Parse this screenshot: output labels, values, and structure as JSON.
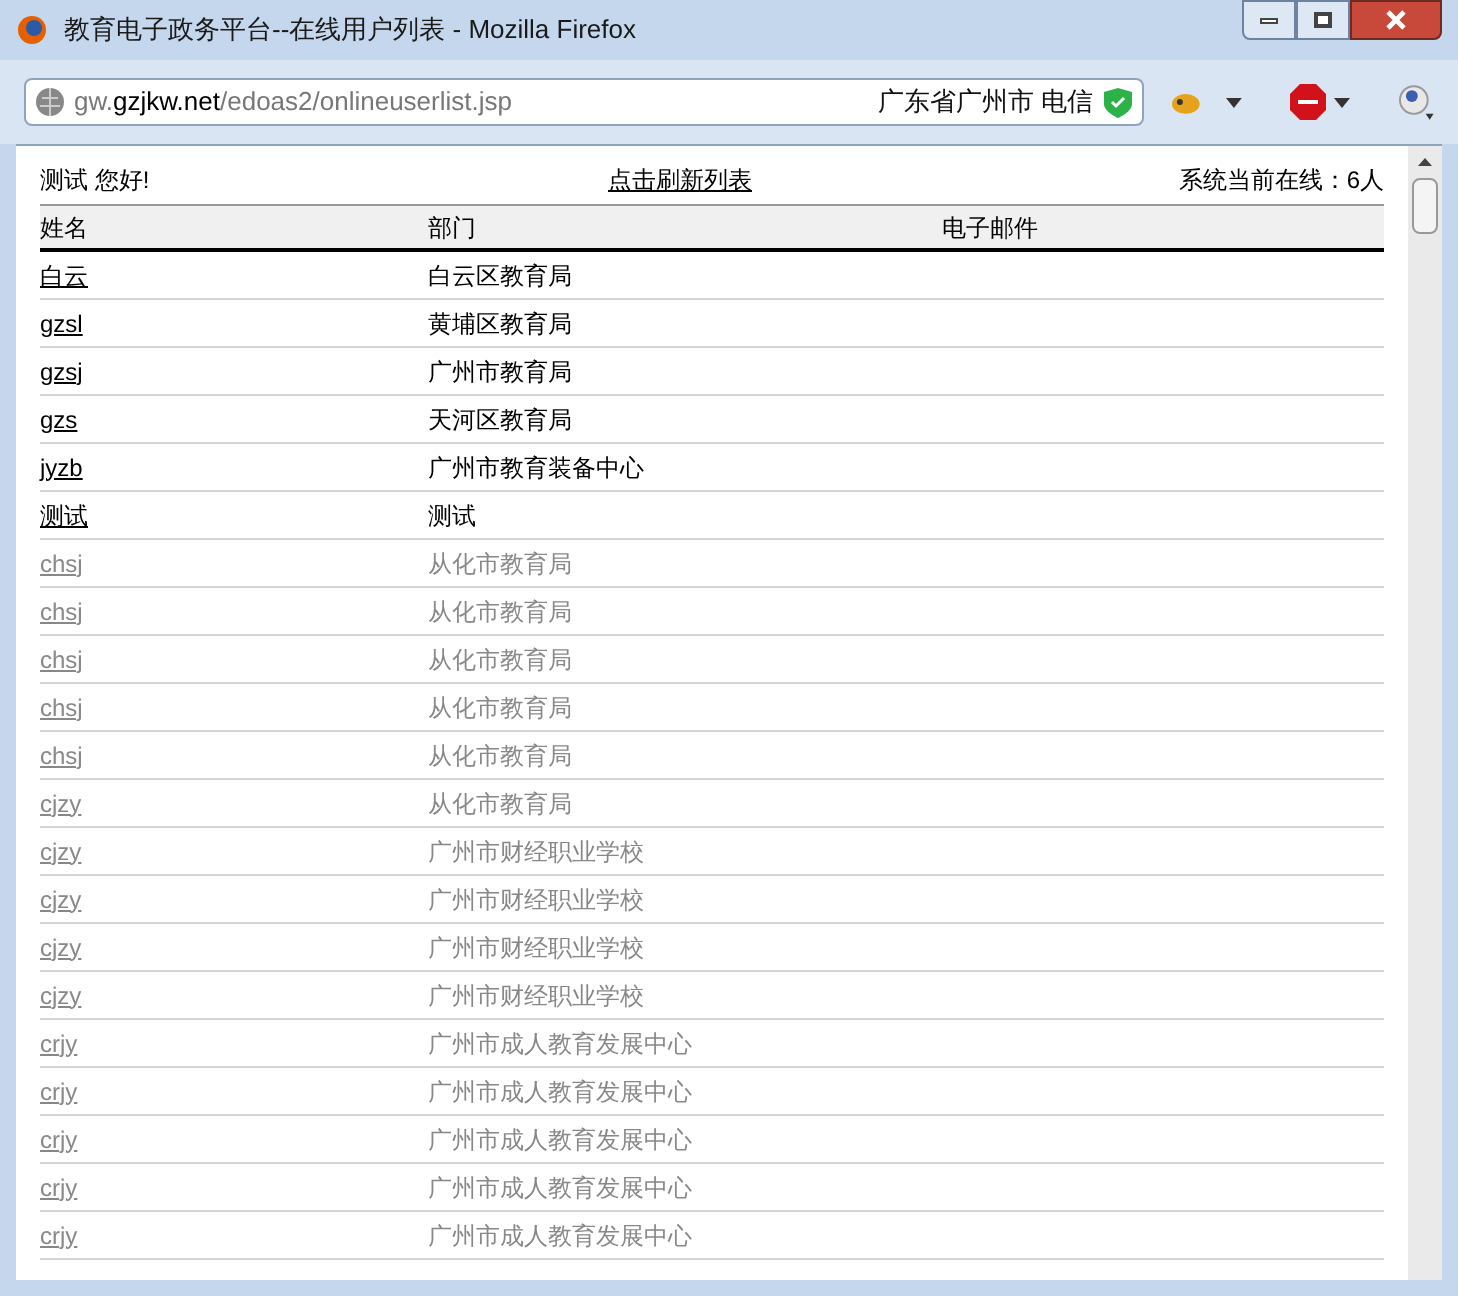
{
  "window": {
    "title": "教育电子政务平台--在线用户列表 - Mozilla Firefox"
  },
  "address_bar": {
    "host_prefix": "gw.",
    "host": "gzjkw.net",
    "path": "/edoas2/onlineuserlist.jsp",
    "location": "广东省广州市 电信"
  },
  "page": {
    "greeting": "测试 您好!",
    "refresh_link": "点击刷新列表",
    "online_count": "系统当前在线：6人"
  },
  "table": {
    "columns": [
      "姓名",
      "部门",
      "电子邮件"
    ],
    "rows": [
      {
        "name": "白云",
        "dept": "白云区教育局",
        "active": true
      },
      {
        "name": "gzsl",
        "dept": "黄埔区教育局",
        "active": true
      },
      {
        "name": "gzsj",
        "dept": "广州市教育局",
        "active": true
      },
      {
        "name": "gzs",
        "dept": "天河区教育局",
        "active": true
      },
      {
        "name": "jyzb",
        "dept": "广州市教育装备中心",
        "active": true
      },
      {
        "name": "测试",
        "dept": "测试",
        "active": true
      },
      {
        "name": "chsj",
        "dept": "从化市教育局",
        "active": false
      },
      {
        "name": "chsj",
        "dept": "从化市教育局",
        "active": false
      },
      {
        "name": "chsj",
        "dept": "从化市教育局",
        "active": false
      },
      {
        "name": "chsj",
        "dept": "从化市教育局",
        "active": false
      },
      {
        "name": "chsj",
        "dept": "从化市教育局",
        "active": false
      },
      {
        "name": "cjzy",
        "dept": "从化市教育局",
        "active": false
      },
      {
        "name": "cjzy",
        "dept": "广州市财经职业学校",
        "active": false
      },
      {
        "name": "cjzy",
        "dept": "广州市财经职业学校",
        "active": false
      },
      {
        "name": "cjzy",
        "dept": "广州市财经职业学校",
        "active": false
      },
      {
        "name": "cjzy",
        "dept": "广州市财经职业学校",
        "active": false
      },
      {
        "name": "crjy",
        "dept": "广州市成人教育发展中心",
        "active": false
      },
      {
        "name": "crjy",
        "dept": "广州市成人教育发展中心",
        "active": false
      },
      {
        "name": "crjy",
        "dept": "广州市成人教育发展中心",
        "active": false
      },
      {
        "name": "crjy",
        "dept": "广州市成人教育发展中心",
        "active": false
      },
      {
        "name": "crjy",
        "dept": "广州市成人教育发展中心",
        "active": false
      }
    ]
  }
}
